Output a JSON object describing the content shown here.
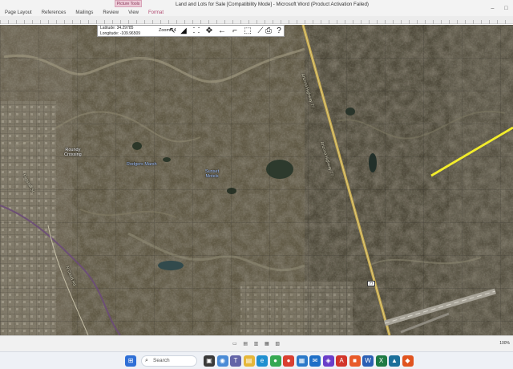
{
  "window": {
    "title": "Land and Lots for Sale [Compatibility Mode]  -  Microsoft Word (Product Activation Failed)",
    "context_group": "Picture Tools",
    "controls": [
      "–",
      "□"
    ]
  },
  "ribbon": {
    "tabs": [
      "Page Layout",
      "References",
      "Mailings",
      "Review",
      "View",
      "Format"
    ]
  },
  "map_toolbar": {
    "latitude": "Latitude: 34.29785",
    "longitude": "Longitude: -109.96509",
    "zoom": "Zoom:14",
    "tools": [
      {
        "name": "pointer-icon",
        "glyph": "↖"
      },
      {
        "name": "eraser-icon",
        "glyph": "◢"
      },
      {
        "name": "measure-icon",
        "glyph": "⸬"
      },
      {
        "name": "pan-icon",
        "glyph": "✥"
      },
      {
        "name": "back-icon",
        "glyph": "←"
      },
      {
        "name": "fit-extent-icon",
        "glyph": "⌐"
      },
      {
        "name": "zoom-box-icon",
        "glyph": "⬚"
      },
      {
        "name": "ruler-icon",
        "glyph": "⟋"
      },
      {
        "name": "print-icon",
        "glyph": "⎙"
      },
      {
        "name": "help-icon",
        "glyph": "?"
      }
    ]
  },
  "map_labels": {
    "town": "Roundy\nCrossing",
    "marsh": "Rodgers Marsh",
    "lake": "Sunset\nMotels",
    "highway_a": "Arizona Highway 77",
    "highway_b": "Arizona Highway 77",
    "road_a": "N Cloud Rd",
    "road_b": "Flagstaff St",
    "shield": "77"
  },
  "status": {
    "zoom_percent": "100%"
  },
  "taskbar": {
    "search_placeholder": "Search",
    "apps": [
      {
        "name": "start-icon",
        "glyph": "⊞",
        "color": "#2f6fd6"
      },
      {
        "name": "task-view-icon",
        "glyph": "▣",
        "color": "#3a3a3a"
      },
      {
        "name": "widgets-icon",
        "glyph": "◉",
        "color": "#4a8bd6"
      },
      {
        "name": "teams-icon",
        "glyph": "T",
        "color": "#6264a7"
      },
      {
        "name": "file-explorer-icon",
        "glyph": "▤",
        "color": "#e6b73a"
      },
      {
        "name": "edge-icon",
        "glyph": "e",
        "color": "#1f8fd0"
      },
      {
        "name": "chrome-icon",
        "glyph": "●",
        "color": "#35a853"
      },
      {
        "name": "chrome-alt-icon",
        "glyph": "●",
        "color": "#d93f32"
      },
      {
        "name": "store-icon",
        "glyph": "▦",
        "color": "#2b79c9"
      },
      {
        "name": "mail-icon",
        "glyph": "✉",
        "color": "#1e6fc7"
      },
      {
        "name": "photos-icon",
        "glyph": "◈",
        "color": "#6a3ec9"
      },
      {
        "name": "acrobat-icon",
        "glyph": "A",
        "color": "#d2352b"
      },
      {
        "name": "pdf-icon",
        "glyph": "■",
        "color": "#e85a2a"
      },
      {
        "name": "word-icon",
        "glyph": "W",
        "color": "#2b5fb4"
      },
      {
        "name": "excel-icon",
        "glyph": "X",
        "color": "#1e7a44"
      },
      {
        "name": "app-icon",
        "glyph": "▲",
        "color": "#1b6f9a"
      },
      {
        "name": "brave-icon",
        "glyph": "◆",
        "color": "#e0531f"
      }
    ]
  }
}
